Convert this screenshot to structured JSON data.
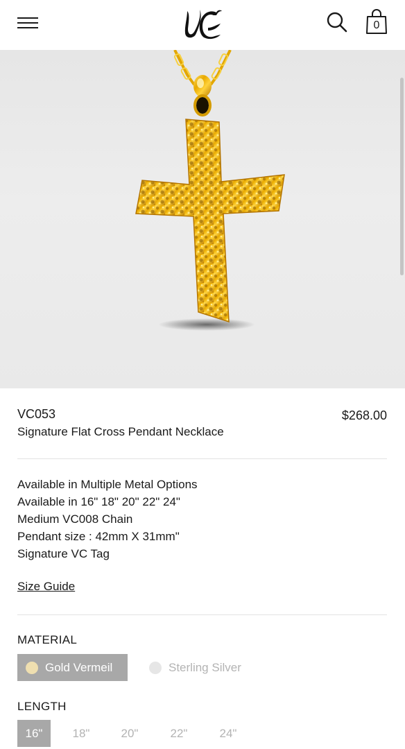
{
  "header": {
    "menu_icon": "hamburger-menu-icon",
    "logo_text": "VC",
    "search_icon": "search-icon",
    "bag_icon": "shopping-bag-icon",
    "bag_count": "0"
  },
  "product": {
    "sku": "VC053",
    "name": "Signature Flat Cross Pendant Necklace",
    "price": "$268.00",
    "description": [
      "Available in Multiple Metal Options",
      "Available in 16\" 18\" 20\" 22\" 24\"",
      "Medium VC008 Chain",
      "Pendant size : 42mm X 31mm\"",
      "Signature VC Tag"
    ],
    "size_guide": "Size Guide"
  },
  "material": {
    "label": "MATERIAL",
    "options": [
      {
        "label": "Gold Vermeil",
        "selected": true,
        "swatch": "#efdfb0"
      },
      {
        "label": "Sterling Silver",
        "selected": false,
        "swatch": "#e6e6e6"
      }
    ]
  },
  "length": {
    "label": "LENGTH",
    "options": [
      "16\"",
      "18\"",
      "20\"",
      "22\"",
      "24\""
    ],
    "selected": "16\""
  },
  "colors": {
    "selected_bg": "#a8a8a8",
    "muted_text": "#b3b3b3",
    "gold": "#e0a800"
  }
}
